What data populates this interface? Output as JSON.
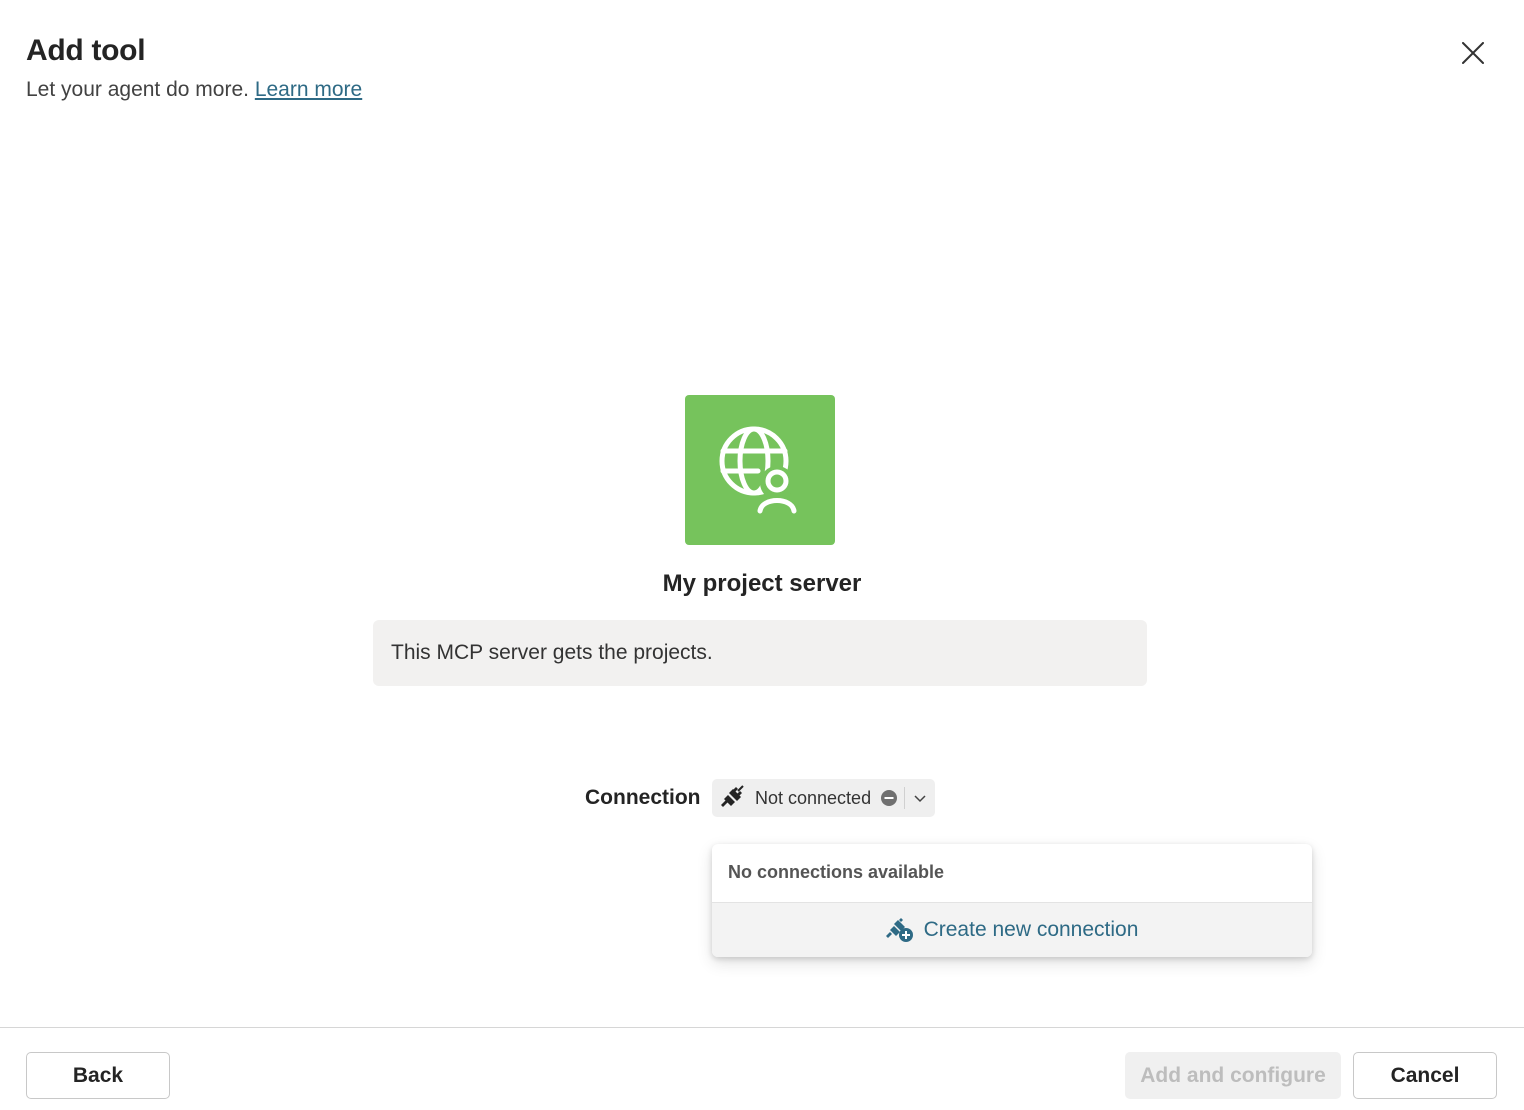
{
  "dialog": {
    "title": "Add tool",
    "subtitle": "Let your agent do more.",
    "learn_more": "Learn more"
  },
  "tool": {
    "icon": "globe-person-icon",
    "icon_bg_color": "#76c35c",
    "name": "My project server",
    "description": "This MCP server gets the projects."
  },
  "connection": {
    "label": "Connection",
    "status": "Not connected",
    "popup": {
      "empty_text": "No connections available",
      "create_label": "Create new connection"
    }
  },
  "footer": {
    "back_label": "Back",
    "add_configure_label": "Add and configure",
    "cancel_label": "Cancel"
  },
  "colors": {
    "accent_link": "#2e6a85",
    "disabled_text": "#bdbdbd"
  }
}
